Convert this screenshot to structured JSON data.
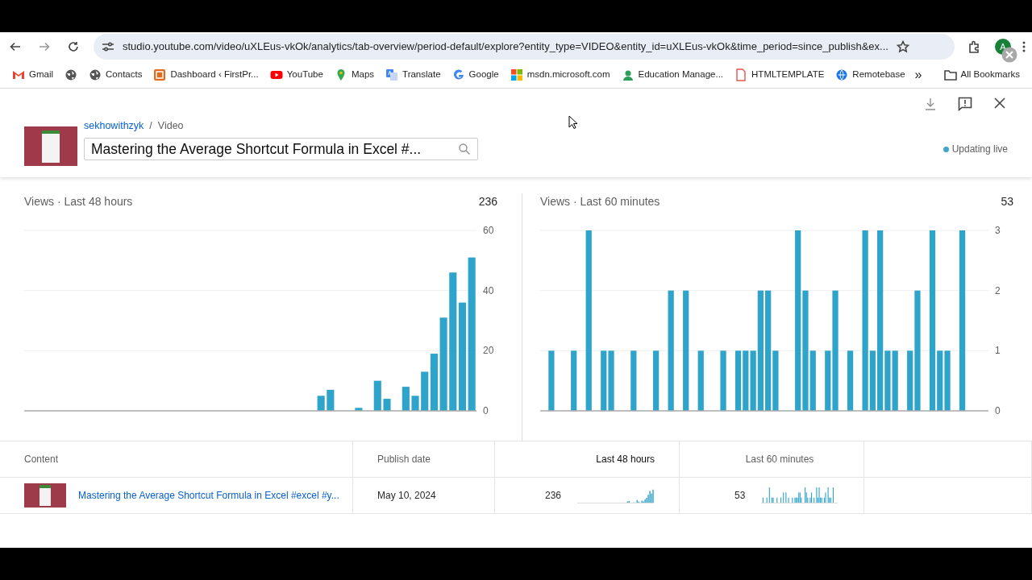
{
  "browser": {
    "url": "studio.youtube.com/video/uXLEus-vkOk/analytics/tab-overview/period-default/explore?entity_type=VIDEO&entity_id=uXLEus-vkOk&time_period=since_publish&ex...",
    "avatar": "A",
    "bookmarks": [
      {
        "kind": "gmail",
        "label": "Gmail"
      },
      {
        "kind": "globe"
      },
      {
        "kind": "globe",
        "label": "Contacts"
      },
      {
        "kind": "dashboard",
        "label": "Dashboard ‹ FirstPr..."
      },
      {
        "kind": "youtube",
        "label": "YouTube"
      },
      {
        "kind": "maps",
        "label": "Maps"
      },
      {
        "kind": "translate",
        "label": "Translate"
      },
      {
        "kind": "google",
        "label": "Google"
      },
      {
        "kind": "microsoft",
        "label": "msdn.microsoft.com"
      },
      {
        "kind": "education",
        "label": "Education Manage..."
      },
      {
        "kind": "template",
        "label": "HTMLTEMPLATE"
      },
      {
        "kind": "remote",
        "label": "Remotebase"
      }
    ],
    "more": "»",
    "all_bookmarks": "All Bookmarks"
  },
  "header": {
    "channel": "sekhowithzyk",
    "separator": "/",
    "type": "Video",
    "title_field": {
      "value": "Mastering the Average Shortcut Formula in Excel #..."
    },
    "live_status": "Updating live"
  },
  "charts": [
    {
      "total": "236",
      "chart_data": {
        "type": "bar",
        "title": "Views · Last 48 hours",
        "ylim": [
          0,
          60
        ],
        "yticks": [
          0,
          20,
          40,
          60
        ],
        "values": [
          0,
          0,
          0,
          0,
          0,
          0,
          0,
          0,
          0,
          0,
          0,
          0,
          0,
          0,
          0,
          0,
          0,
          0,
          0,
          0,
          0,
          0,
          0,
          0,
          0,
          0,
          0,
          0,
          0,
          0,
          0,
          5,
          7,
          0,
          0,
          1,
          0,
          10,
          4,
          0,
          8,
          5,
          13,
          19,
          31,
          46,
          36,
          51
        ]
      }
    },
    {
      "total": "53",
      "chart_data": {
        "type": "bar",
        "title": "Views · Last 60 minutes",
        "ylim": [
          0,
          3
        ],
        "yticks": [
          0,
          1,
          2,
          3
        ],
        "values": [
          0,
          1,
          0,
          0,
          1,
          0,
          3,
          0,
          1,
          1,
          0,
          0,
          1,
          0,
          0,
          1,
          0,
          2,
          0,
          2,
          0,
          1,
          0,
          0,
          1,
          0,
          1,
          1,
          1,
          2,
          2,
          1,
          0,
          0,
          3,
          2,
          1,
          0,
          1,
          2,
          0,
          1,
          0,
          3,
          1,
          3,
          1,
          1,
          0,
          1,
          2,
          0,
          3,
          1,
          1,
          0,
          3,
          0,
          0,
          0
        ]
      }
    }
  ],
  "table": {
    "columns": [
      "Content",
      "Publish date",
      "Last 48 hours",
      "Last 60 minutes"
    ],
    "rows": [
      {
        "title": "Mastering the Average Shortcut Formula in Excel #excel #y...",
        "publish_date": "May 10, 2024",
        "views_48h": "236",
        "views_60m": "53"
      }
    ]
  }
}
